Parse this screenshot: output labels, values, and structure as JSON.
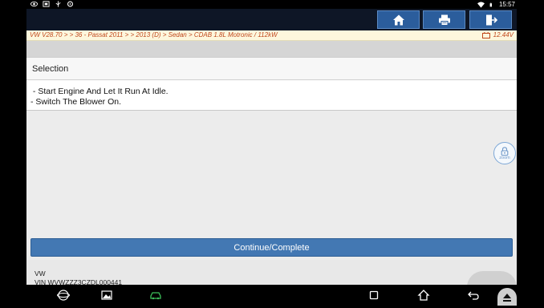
{
  "status_bar": {
    "time": "15:57",
    "icons": [
      "eye-icon",
      "screenshot-icon",
      "usb-icon",
      "settings-icon",
      "wifi-icon",
      "battery-icon"
    ]
  },
  "toolbar": {
    "buttons": [
      "home-icon",
      "print-icon",
      "exit-icon"
    ],
    "accent": "#2b5d9c"
  },
  "breadcrumb": {
    "path": "VW V28.70 > > 36 - Passat 2011 > > 2013 (D) > Sedan > CDAB 1.8L Motronic / 112kW",
    "voltage": "12.44V"
  },
  "section": {
    "title": "Selection"
  },
  "message": {
    "line1": " - Start Engine And Let It Run At Idle.",
    "line2": "- Switch The Blower On."
  },
  "zoom": {
    "label": "zoom"
  },
  "actions": {
    "continue_label": "Continue/Complete",
    "button_color": "#4378b3"
  },
  "vehicle": {
    "make": "VW",
    "vin": "VIN WVWZZZ3CZDL000441"
  },
  "nav_bar": {
    "icons": [
      "browser-icon",
      "gallery-icon",
      "vci-icon",
      "recents-icon",
      "home-icon",
      "back-icon",
      "eject-icon"
    ]
  }
}
